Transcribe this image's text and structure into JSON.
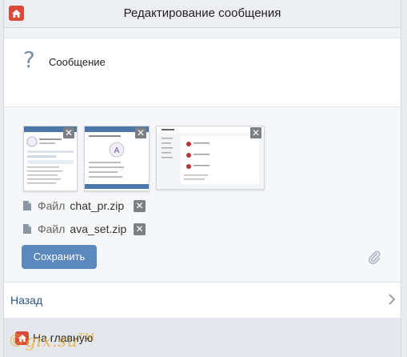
{
  "header": {
    "title": "Редактирование сообщения",
    "home_icon": "home-icon"
  },
  "message": {
    "icon": "question-icon",
    "icon_glyph": "?",
    "text": "Сообщение"
  },
  "attachments": {
    "photos": [
      {
        "name": "screenshot-chat",
        "close_glyph": "✕"
      },
      {
        "name": "screenshot-avatar",
        "close_glyph": "✕"
      },
      {
        "name": "screenshot-desktop",
        "close_glyph": "✕"
      }
    ],
    "files": [
      {
        "label": "Файл",
        "name": "chat_pr.zip",
        "close_glyph": "✕"
      },
      {
        "label": "Файл",
        "name": "ava_set.zip",
        "close_glyph": "✕"
      }
    ]
  },
  "save_button": {
    "label": "Сохранить"
  },
  "attach_icon": "paperclip-icon",
  "back": {
    "label": "Назад",
    "icon": "chevron-right-icon"
  },
  "footer": {
    "label": "На главную",
    "icon": "home-icon"
  },
  "watermark": {
    "text": "©gix.su",
    "tm": "TM"
  },
  "colors": {
    "accent": "#5b88bd",
    "home": "#d94a3a",
    "link": "#2a5885"
  }
}
